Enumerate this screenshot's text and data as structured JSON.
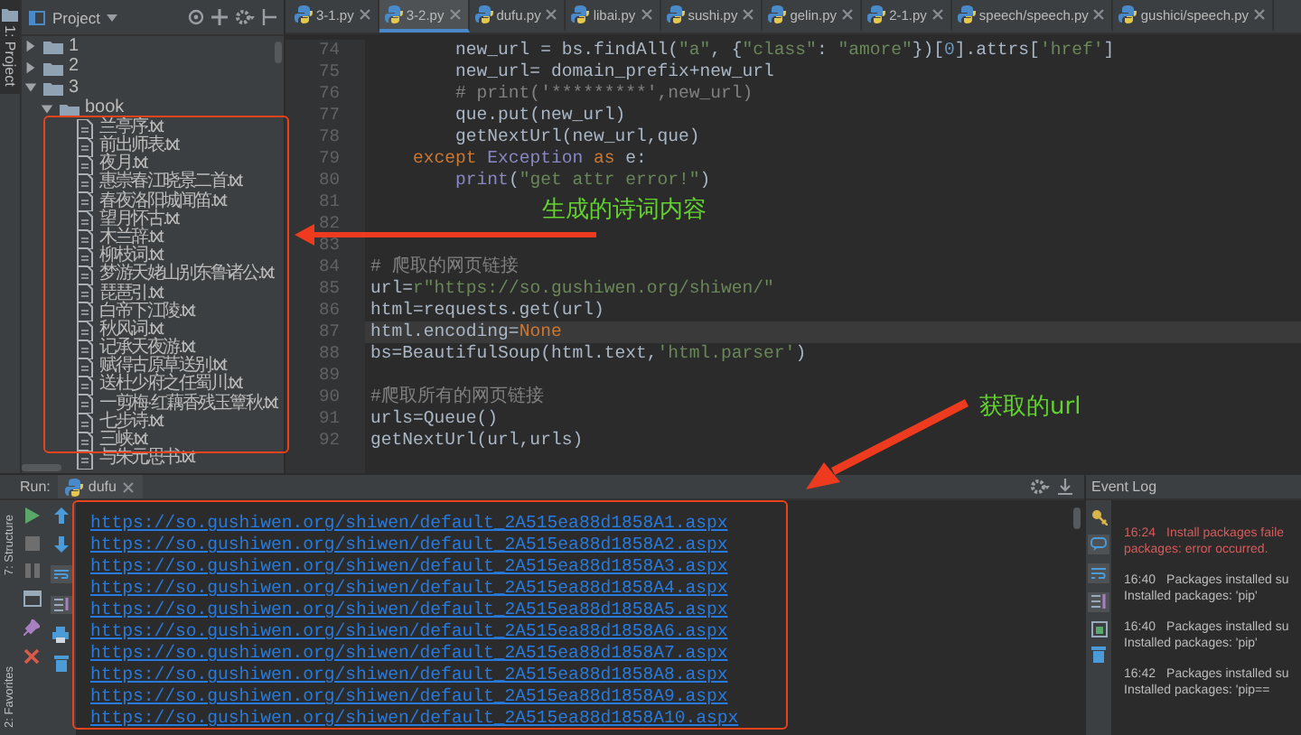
{
  "sidebar_strip": {
    "label": "1: Project"
  },
  "project": {
    "title": "Project",
    "tree": [
      {
        "label": "1",
        "kind": "folder",
        "expanded": false
      },
      {
        "label": "2",
        "kind": "folder",
        "expanded": false
      },
      {
        "label": "3",
        "kind": "folder",
        "expanded": true,
        "children": [
          {
            "label": "book",
            "kind": "folder",
            "expanded": true,
            "children": [
              {
                "label": "兰亭序.txt",
                "kind": "file"
              },
              {
                "label": "前出师表.txt",
                "kind": "file"
              },
              {
                "label": "夜月.txt",
                "kind": "file"
              },
              {
                "label": "惠崇春江晓景二首.txt",
                "kind": "file"
              },
              {
                "label": "春夜洛阳城闻笛.txt",
                "kind": "file"
              },
              {
                "label": "望月怀古.txt",
                "kind": "file"
              },
              {
                "label": "木兰辞.txt",
                "kind": "file"
              },
              {
                "label": "柳枝词.txt",
                "kind": "file"
              },
              {
                "label": "梦游天姥山别东鲁诸公.txt",
                "kind": "file"
              },
              {
                "label": "琵琶引.txt",
                "kind": "file"
              },
              {
                "label": "白帝下江陵.txt",
                "kind": "file"
              },
              {
                "label": "秋风词.txt",
                "kind": "file"
              },
              {
                "label": "记承天夜游.txt",
                "kind": "file"
              },
              {
                "label": "赋得古原草送别.txt",
                "kind": "file"
              },
              {
                "label": "送杜少府之任蜀川.txt",
                "kind": "file"
              },
              {
                "label": "一剪梅·红藕香残玉簟秋.txt",
                "kind": "file"
              },
              {
                "label": "七步诗.txt",
                "kind": "file"
              },
              {
                "label": "三峡.txt",
                "kind": "file"
              },
              {
                "label": "与朱元思书.txt",
                "kind": "file"
              }
            ]
          }
        ]
      }
    ]
  },
  "editor": {
    "tabs": [
      {
        "label": "3-1.py",
        "selected": false
      },
      {
        "label": "3-2.py",
        "selected": true
      },
      {
        "label": "dufu.py",
        "selected": false
      },
      {
        "label": "libai.py",
        "selected": false
      },
      {
        "label": "sushi.py",
        "selected": false
      },
      {
        "label": "gelin.py",
        "selected": false
      },
      {
        "label": "2-1.py",
        "selected": false
      },
      {
        "label": "speech/speech.py",
        "selected": false
      },
      {
        "label": "gushici/speech.py",
        "selected": false
      }
    ],
    "lines": [
      {
        "number": "74",
        "current": false,
        "tokens": [
          {
            "text": "        new_url = bs.findAll(",
            "kind": "plain"
          },
          {
            "text": "\"a\"",
            "kind": "string"
          },
          {
            "text": ", {",
            "kind": "plain"
          },
          {
            "text": "\"class\"",
            "kind": "string"
          },
          {
            "text": ": ",
            "kind": "plain"
          },
          {
            "text": "\"amore\"",
            "kind": "string"
          },
          {
            "text": "})[",
            "kind": "plain"
          },
          {
            "text": "0",
            "kind": "number"
          },
          {
            "text": "].attrs[",
            "kind": "plain"
          },
          {
            "text": "'href'",
            "kind": "string"
          },
          {
            "text": "]",
            "kind": "plain"
          }
        ]
      },
      {
        "number": "75",
        "current": false,
        "tokens": [
          {
            "text": "        new_url= domain_prefix+new_url",
            "kind": "plain"
          }
        ]
      },
      {
        "number": "76",
        "current": false,
        "tokens": [
          {
            "text": "        # print('*********',new_url)",
            "kind": "comment"
          }
        ]
      },
      {
        "number": "77",
        "current": false,
        "tokens": [
          {
            "text": "        que.put(new_url)",
            "kind": "plain"
          }
        ]
      },
      {
        "number": "78",
        "current": false,
        "tokens": [
          {
            "text": "        getNextUrl(new_url,que)",
            "kind": "plain"
          }
        ]
      },
      {
        "number": "79",
        "current": false,
        "tokens": [
          {
            "text": "    except",
            "kind": "keyword"
          },
          {
            "text": " Exception",
            "kind": "class"
          },
          {
            "text": " as",
            "kind": "keyword"
          },
          {
            "text": " e:",
            "kind": "plain"
          }
        ]
      },
      {
        "number": "80",
        "current": false,
        "tokens": [
          {
            "text": "        print",
            "kind": "builtin"
          },
          {
            "text": "(",
            "kind": "plain"
          },
          {
            "text": "\"get attr error!\"",
            "kind": "string"
          },
          {
            "text": ")",
            "kind": "plain"
          }
        ]
      },
      {
        "number": "81",
        "current": false
      },
      {
        "number": "82",
        "current": false
      },
      {
        "number": "83",
        "current": false
      },
      {
        "number": "84",
        "current": false,
        "tokens": [
          {
            "text": "# 爬取的网页链接",
            "kind": "comment"
          }
        ]
      },
      {
        "number": "85",
        "current": false,
        "tokens": [
          {
            "text": "url=",
            "kind": "plain"
          },
          {
            "text": "r\"https://so.gushiwen.org/shiwen/\"",
            "kind": "string"
          }
        ]
      },
      {
        "number": "86",
        "current": false,
        "tokens": [
          {
            "text": "html=requests.get(url)",
            "kind": "plain"
          }
        ]
      },
      {
        "number": "87",
        "current": true,
        "tokens": [
          {
            "text": "html.encoding=",
            "kind": "plain"
          },
          {
            "text": "None",
            "kind": "keyword"
          }
        ]
      },
      {
        "number": "88",
        "current": false,
        "tokens": [
          {
            "text": "bs=BeautifulSoup(html.text,",
            "kind": "plain"
          },
          {
            "text": "'html.parser'",
            "kind": "string"
          },
          {
            "text": ")",
            "kind": "plain"
          }
        ]
      },
      {
        "number": "89",
        "current": false
      },
      {
        "number": "90",
        "current": false,
        "tokens": [
          {
            "text": "#爬取所有的网页链接",
            "kind": "comment"
          }
        ]
      },
      {
        "number": "91",
        "current": false,
        "tokens": [
          {
            "text": "urls=Queue()",
            "kind": "plain"
          }
        ]
      },
      {
        "number": "92",
        "current": false,
        "tokens": [
          {
            "text": "getNextUrl(url,urls)",
            "kind": "plain"
          }
        ]
      }
    ]
  },
  "run": {
    "title": "Run:",
    "tab": "dufu",
    "side_labels": [
      "7: Structure",
      "2: Favorites"
    ],
    "output": [
      "https://so.gushiwen.org/shiwen/default_2A515ea88d1858A1.aspx",
      "https://so.gushiwen.org/shiwen/default_2A515ea88d1858A2.aspx",
      "https://so.gushiwen.org/shiwen/default_2A515ea88d1858A3.aspx",
      "https://so.gushiwen.org/shiwen/default_2A515ea88d1858A4.aspx",
      "https://so.gushiwen.org/shiwen/default_2A515ea88d1858A5.aspx",
      "https://so.gushiwen.org/shiwen/default_2A515ea88d1858A6.aspx",
      "https://so.gushiwen.org/shiwen/default_2A515ea88d1858A7.aspx",
      "https://so.gushiwen.org/shiwen/default_2A515ea88d1858A8.aspx",
      "https://so.gushiwen.org/shiwen/default_2A515ea88d1858A9.aspx",
      "https://so.gushiwen.org/shiwen/default_2A515ea88d1858A10.aspx"
    ]
  },
  "event_log": {
    "title": "Event Log",
    "entries": [
      {
        "time": "16:24",
        "message": "Install packages faile",
        "detail": "packages: error occurred.",
        "kind": "error"
      },
      {
        "time": "16:40",
        "message": "Packages installed su",
        "detail": "Installed packages: 'pip'",
        "kind": "info"
      },
      {
        "time": "16:40",
        "message": "Packages installed su",
        "detail": "Installed packages: 'pip'",
        "kind": "info"
      },
      {
        "time": "16:42",
        "message": "Packages installed su",
        "detail": "Installed packages: 'pip==",
        "kind": "info"
      }
    ]
  },
  "annotations": {
    "labels": [
      "生成的诗词内容",
      "获取的url"
    ]
  }
}
